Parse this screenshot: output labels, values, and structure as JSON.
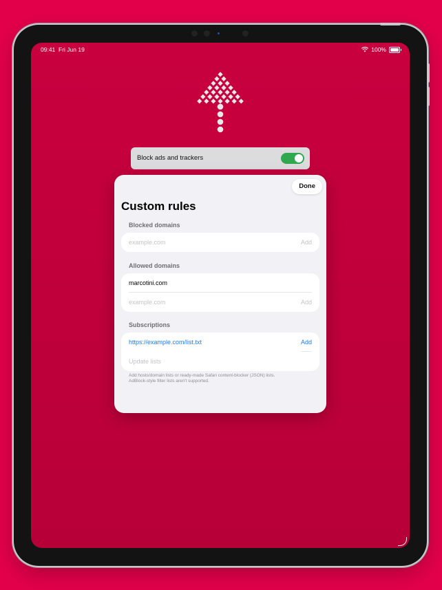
{
  "status": {
    "time": "09:41",
    "date": "Fri Jun 19",
    "battery": "100%"
  },
  "toggle": {
    "label": "Block ads and trackers",
    "on": true
  },
  "sheet": {
    "done_label": "Done",
    "title": "Custom rules",
    "blocked": {
      "header": "Blocked domains",
      "placeholder": "example.com",
      "add_label": "Add"
    },
    "allowed": {
      "header": "Allowed domains",
      "items": [
        "marcotini.com"
      ],
      "placeholder": "example.com",
      "add_label": "Add"
    },
    "subscriptions": {
      "header": "Subscriptions",
      "url": "https://example.com/list.txt",
      "add_label": "Add",
      "update_label": "Update lists",
      "footnote_line1": "Add hosts/domain lists or ready-made Safari content-blocker (JSON) lists.",
      "footnote_line2": "AdBlock-style filter lists aren't supported."
    }
  },
  "colors": {
    "background": "#e2004a",
    "screen": "#c8003e",
    "accent": "#1a7cf2",
    "switch_on": "#2fa84f"
  }
}
